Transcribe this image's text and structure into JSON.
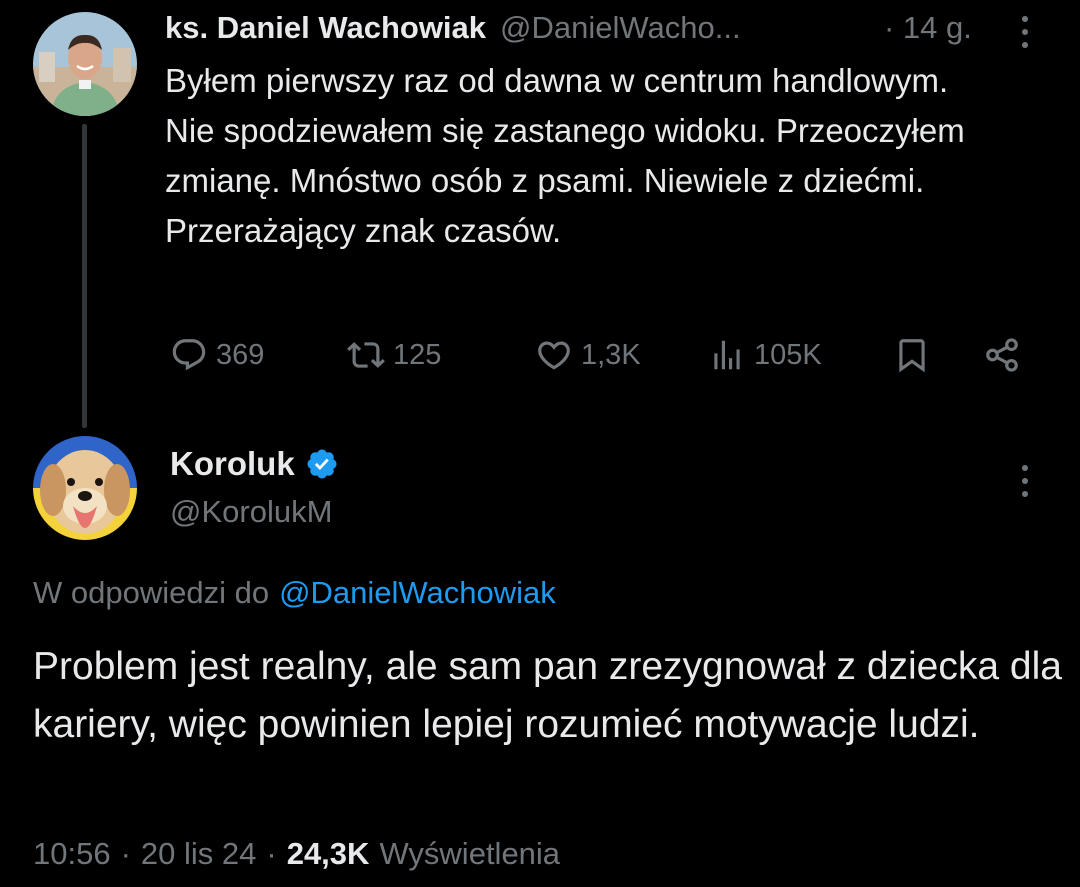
{
  "parent_tweet": {
    "author_name": "ks. Daniel Wachowiak",
    "author_handle": "@DanielWacho...",
    "time": "· 14 g.",
    "text": "Byłem pierwszy raz od dawna w centrum handlowym. Nie spodziewałem się zastanego widoku. Przeoczyłem zmianę. Mnóstwo osób z psami. Niewiele z dziećmi. Przerażający znak czasów.",
    "replies": "369",
    "retweets": "125",
    "likes": "1,3K",
    "views": "105K"
  },
  "reply_tweet": {
    "author_name": "Koroluk",
    "author_handle": "@KorolukM",
    "reply_prefix": "W odpowiedzi do",
    "reply_to": "@DanielWachowiak",
    "text": "Problem jest realny, ale sam pan zrezygnował z dziecka dla kariery, więc powinien lepiej rozumieć motywacje ludzi.",
    "time": "10:56",
    "date": "20 lis 24",
    "views_count": "24,3K",
    "views_label": "Wyświetlenia"
  },
  "colors": {
    "background": "#000000",
    "text_primary": "#e7e9ea",
    "text_secondary": "#71767b",
    "accent": "#1d9bf0",
    "thread_line": "#333639"
  },
  "icons": {
    "reply": "speech-bubble-icon",
    "retweet": "retweet-icon",
    "like": "heart-icon",
    "views": "bar-chart-icon",
    "bookmark": "bookmark-icon",
    "share": "share-icon",
    "more": "vertical-dots-icon",
    "verified": "verified-badge-icon"
  }
}
